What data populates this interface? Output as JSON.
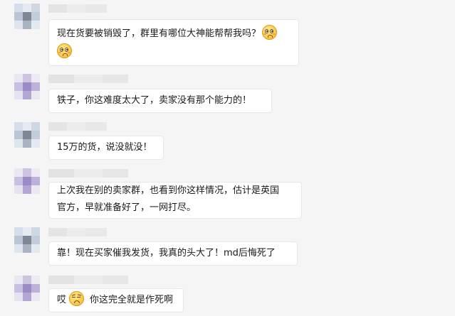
{
  "messages": [
    {
      "lines": [
        "现在货要被销毁了，群里有哪位大神能帮帮我吗？",
        ""
      ],
      "emoji": "flushed-emoji"
    },
    {
      "lines": [
        "铁子，你这难度太大了，卖家没有那个能力的！"
      ]
    },
    {
      "lines": [
        "15万的货，说没就没！"
      ]
    },
    {
      "lines": [
        "上次我在别的卖家群，也看到你这样情况，估计是英国",
        "官方，早就准备好了，一网打尽。"
      ]
    },
    {
      "lines": [
        "靠！现在买家催我发货，我真的头大了！md后悔死了"
      ]
    },
    {
      "prefix": "哎",
      "suffix": "你这完全就是作死啊",
      "emoji": "frowning-emoji"
    }
  ],
  "colors": {
    "background": "#f5f5f5",
    "bubble": "#ffffff",
    "bubble_border": "#e8e8e8",
    "text": "#1a1a1a"
  }
}
